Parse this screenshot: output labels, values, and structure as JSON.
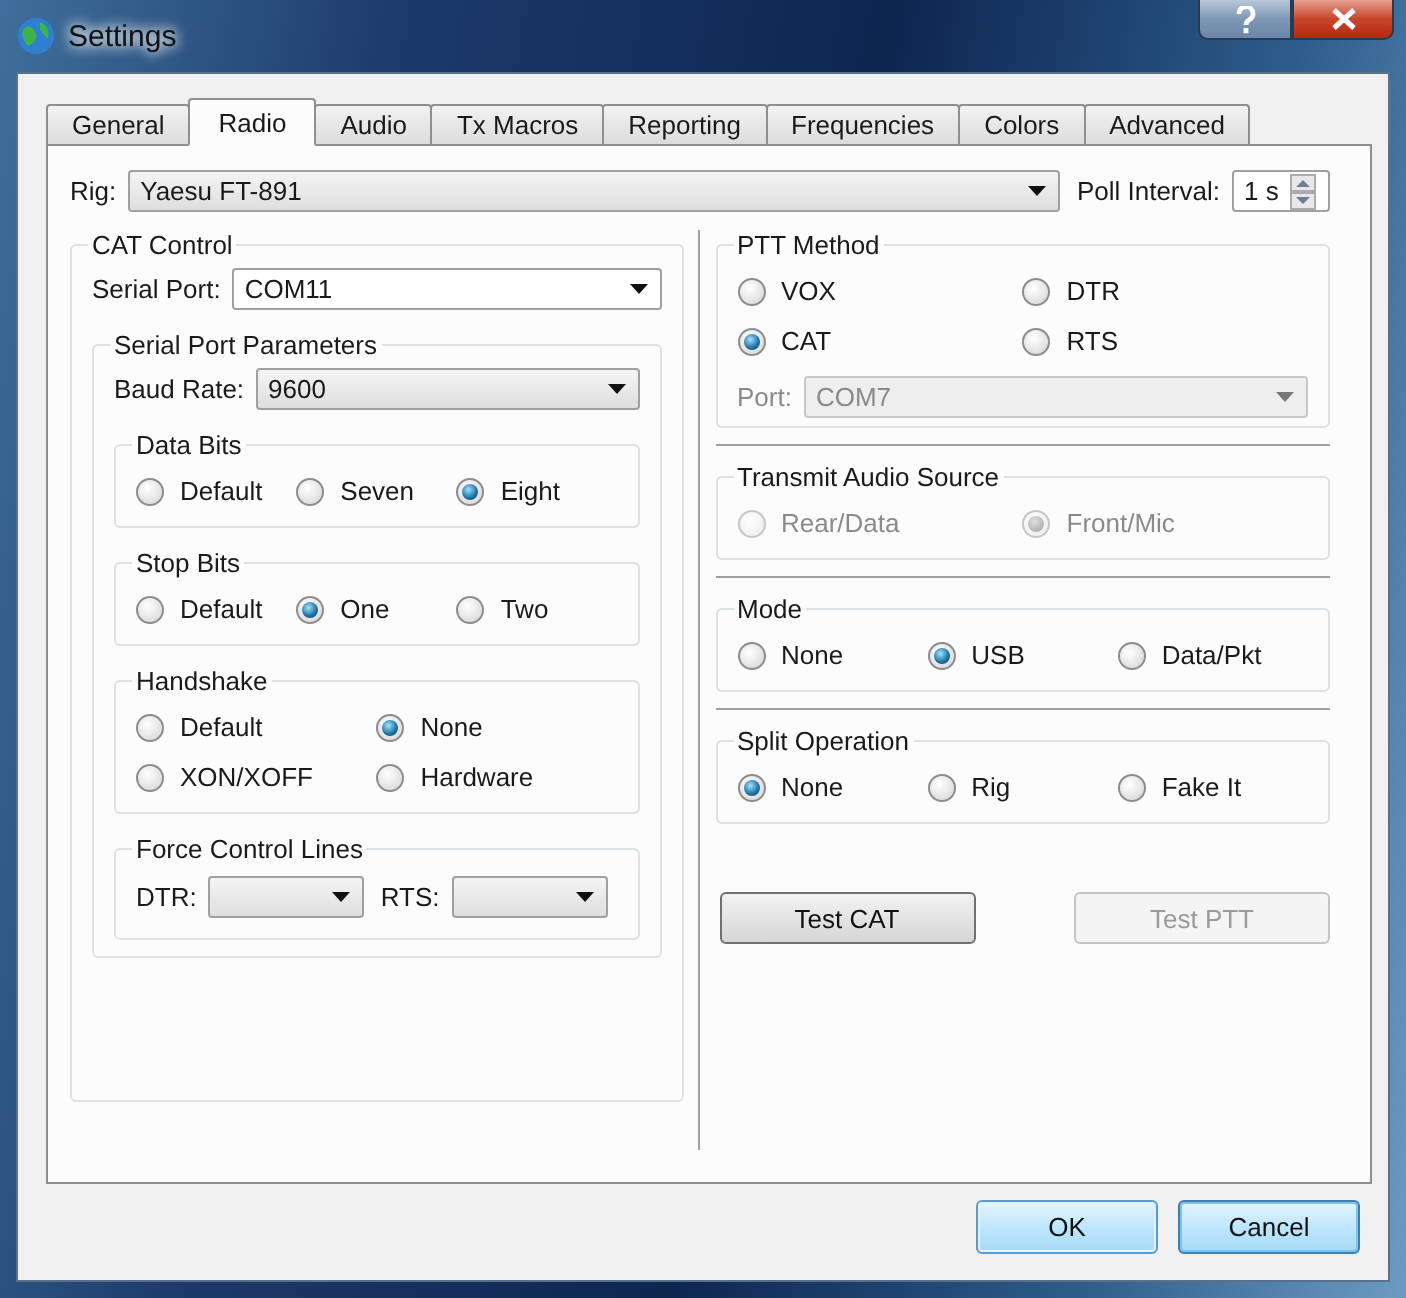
{
  "window": {
    "title": "Settings"
  },
  "tabs": [
    {
      "label": "General",
      "selected": false
    },
    {
      "label": "Radio",
      "selected": true
    },
    {
      "label": "Audio",
      "selected": false
    },
    {
      "label": "Tx Macros",
      "selected": false
    },
    {
      "label": "Reporting",
      "selected": false
    },
    {
      "label": "Frequencies",
      "selected": false
    },
    {
      "label": "Colors",
      "selected": false
    },
    {
      "label": "Advanced",
      "selected": false
    }
  ],
  "rig": {
    "label": "Rig:",
    "value": "Yaesu FT-891"
  },
  "poll_interval": {
    "label": "Poll Interval:",
    "value": "1 s"
  },
  "cat_control": {
    "title": "CAT Control",
    "serial_port": {
      "label": "Serial Port:",
      "value": "COM11"
    },
    "serial_port_parameters": {
      "title": "Serial Port Parameters",
      "baud_rate": {
        "label": "Baud Rate:",
        "value": "9600"
      },
      "groups": [
        {
          "title": "Data Bits",
          "options": [
            {
              "label": "Default",
              "selected": false,
              "disabled": false
            },
            {
              "label": "Seven",
              "selected": false,
              "disabled": false
            },
            {
              "label": "Eight",
              "selected": true,
              "disabled": false
            }
          ]
        },
        {
          "title": "Stop Bits",
          "options": [
            {
              "label": "Default",
              "selected": false,
              "disabled": false
            },
            {
              "label": "One",
              "selected": true,
              "disabled": false
            },
            {
              "label": "Two",
              "selected": false,
              "disabled": false
            }
          ]
        },
        {
          "title": "Handshake",
          "options": [
            {
              "label": "Default",
              "selected": false,
              "disabled": false
            },
            {
              "label": "None",
              "selected": true,
              "disabled": false
            },
            {
              "label": "XON/XOFF",
              "selected": false,
              "disabled": false
            },
            {
              "label": "Hardware",
              "selected": false,
              "disabled": false
            }
          ]
        }
      ],
      "force_control_lines": {
        "title": "Force Control Lines",
        "lines": [
          {
            "label": "DTR:"
          },
          {
            "label": "RTS:"
          }
        ]
      }
    }
  },
  "ptt_method": {
    "title": "PTT Method",
    "options": [
      {
        "label": "VOX",
        "selected": false,
        "disabled": false
      },
      {
        "label": "DTR",
        "selected": false,
        "disabled": false
      },
      {
        "label": "CAT",
        "selected": true,
        "disabled": false
      },
      {
        "label": "RTS",
        "selected": false,
        "disabled": false
      }
    ],
    "port": {
      "label": "Port:",
      "value": "COM7",
      "disabled": true
    }
  },
  "right_groups": [
    {
      "title": "Transmit Audio Source",
      "options": [
        {
          "label": "Rear/Data",
          "selected": false,
          "disabled": true
        },
        {
          "label": "Front/Mic",
          "selected": true,
          "disabled": true
        }
      ]
    },
    {
      "title": "Mode",
      "options": [
        {
          "label": "None",
          "selected": false,
          "disabled": false
        },
        {
          "label": "USB",
          "selected": true,
          "disabled": false
        },
        {
          "label": "Data/Pkt",
          "selected": false,
          "disabled": false
        }
      ]
    },
    {
      "title": "Split Operation",
      "options": [
        {
          "label": "None",
          "selected": true,
          "disabled": false
        },
        {
          "label": "Rig",
          "selected": false,
          "disabled": false
        },
        {
          "label": "Fake It",
          "selected": false,
          "disabled": false
        }
      ]
    }
  ],
  "actions": [
    {
      "label": "Test CAT",
      "disabled": false
    },
    {
      "label": "Test PTT",
      "disabled": true
    }
  ],
  "buttons": [
    {
      "label": "OK",
      "default": true
    },
    {
      "label": "Cancel",
      "default": false
    }
  ]
}
